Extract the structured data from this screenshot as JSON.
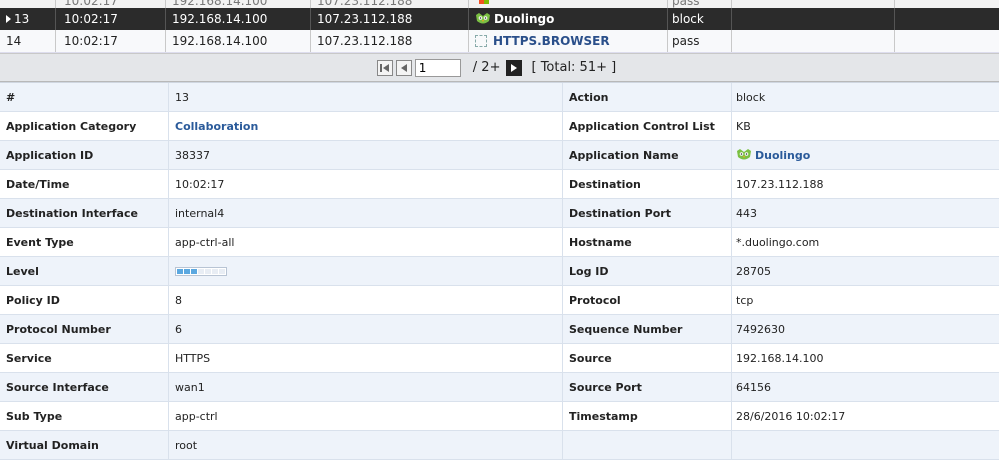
{
  "log_rows": [
    {
      "num": "",
      "time": "10:02:17",
      "source": "192.168.14.100",
      "dest": "107.23.112.188",
      "app": "",
      "action": "pass",
      "state": "partial"
    },
    {
      "num": "13",
      "time": "10:02:17",
      "source": "192.168.14.100",
      "dest": "107.23.112.188",
      "app": "Duolingo",
      "action": "block",
      "state": "selected"
    },
    {
      "num": "14",
      "time": "10:02:17",
      "source": "192.168.14.100",
      "dest": "107.23.112.188",
      "app": "HTTPS.BROWSER",
      "action": "pass",
      "state": "normal"
    }
  ],
  "pager": {
    "page_value": "1",
    "of_text": "/ 2+",
    "total_text": "[ Total: 51+ ]"
  },
  "details": [
    {
      "k1": "#",
      "v1": "13",
      "k2": "Action",
      "v2": "block"
    },
    {
      "k1": "Application Category",
      "v1": "Collaboration",
      "k2": "Application Control List",
      "v2": "KB"
    },
    {
      "k1": "Application ID",
      "v1": "38337",
      "k2": "Application Name",
      "v2": "Duolingo"
    },
    {
      "k1": "Date/Time",
      "v1": "10:02:17",
      "k2": "Destination",
      "v2": "107.23.112.188"
    },
    {
      "k1": "Destination Interface",
      "v1": "internal4",
      "k2": "Destination Port",
      "v2": "443"
    },
    {
      "k1": "Event Type",
      "v1": "app-ctrl-all",
      "k2": "Hostname",
      "v2": "*.duolingo.com"
    },
    {
      "k1": "Level",
      "v1": "",
      "k2": "Log ID",
      "v2": "28705"
    },
    {
      "k1": "Policy ID",
      "v1": "8",
      "k2": "Protocol",
      "v2": "tcp"
    },
    {
      "k1": "Protocol Number",
      "v1": "6",
      "k2": "Sequence Number",
      "v2": "7492630"
    },
    {
      "k1": "Service",
      "v1": "HTTPS",
      "k2": "Source",
      "v2": "192.168.14.100"
    },
    {
      "k1": "Source Interface",
      "v1": "wan1",
      "k2": "Source Port",
      "v2": "64156"
    },
    {
      "k1": "Sub Type",
      "v1": "app-ctrl",
      "k2": "Timestamp",
      "v2": "28/6/2016 10:02:17"
    },
    {
      "k1": "Virtual Domain",
      "v1": "root",
      "k2": "",
      "v2": ""
    }
  ],
  "level_meter": {
    "filled": 3,
    "total": 7
  },
  "icons": {
    "app_duolingo": "owl-icon",
    "app_https": "placeholder-icon",
    "row_marker": "selected-row-arrow-icon"
  },
  "colors": {
    "selected_row": "#2b2b2b",
    "link": "#2a5a9a",
    "odd_row": "#eef3fa",
    "level_on": "#5ba8e0"
  }
}
